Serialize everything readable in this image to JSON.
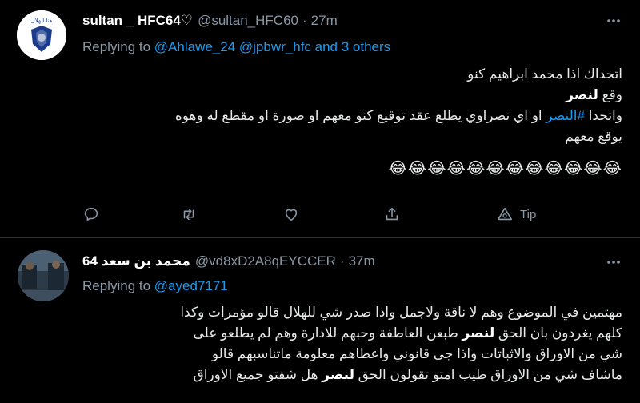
{
  "tweet1": {
    "display_name": "sultan _ HFC64♡",
    "handle": "@sultan_HFC60",
    "time": "27m",
    "replying_label": "Replying to",
    "replying_to": "@Ahlawe_24 @jpbwr_hfc and 3 others",
    "line1": "اتحداك اذا محمد ابراهيم كنو",
    "line2_a": "وقع ",
    "line2_b": "لنصر",
    "line3_a": "واتحدا ",
    "line3_tag": "#النصر",
    "line3_b": " او اي نصراوي يطلع عقد توقيع كنو معهم او صورة او مقطع له وهوه",
    "line4": "يوقع معهم",
    "emojis": "😂😂😂😂😂😂😂😂😂😂😂😂",
    "tip_label": "Tip"
  },
  "tweet2": {
    "display_name": "محمد بن سعد 64",
    "handle": "@vd8xD2A8qEYCCER",
    "time": "37m",
    "replying_label": "Replying to",
    "replying_to": "@ayed7171",
    "line1": "مهتمين في الموضوع وهم لا ناقة ولاجمل واذا صدر شي للهلال قالو مؤمرات وكذا",
    "line2_a": "كلهم يغردون بان الحق ",
    "line2_b": "لنصر",
    "line2_c": " طبعن العاطفة وحبهم للادارة وهم لم يطلعو على",
    "line3": "شي من الاوراق والاثباتات واذا جى قانوني واعطاهم معلومة ماتناسبهم قالو",
    "line4_a": "ماشاف شي من الاوراق طيب امتو تقولون الحق ",
    "line4_b": "لنصر",
    "line4_c": " هل شفتو جميع الاوراق"
  },
  "colors": {
    "background": "#000000",
    "text": "#e7e9ea",
    "secondary": "#8b98a5",
    "link": "#1d9bf0",
    "divider": "#2f3336"
  }
}
